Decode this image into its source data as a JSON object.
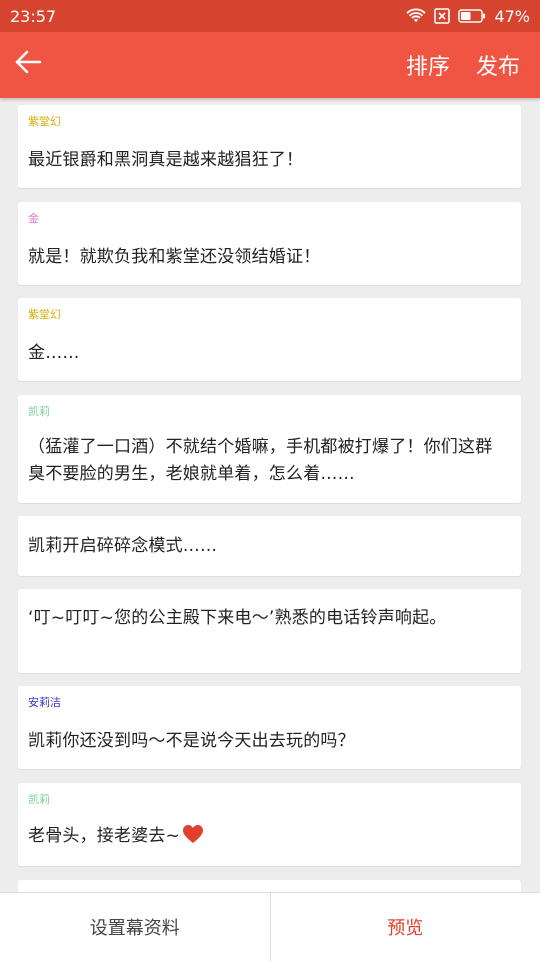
{
  "status_bar": {
    "time": "23:57",
    "battery": "47%",
    "icons": [
      "wifi-icon",
      "sim-off-icon",
      "battery-icon"
    ]
  },
  "header": {
    "back_icon": "arrow-left-icon",
    "sort_label": "排序",
    "publish_label": "发布",
    "background": "#f05442"
  },
  "messages": [
    {
      "speaker": "紫堂幻",
      "speaker_color": "#d9b000",
      "text": "最近银爵和黑洞真是越来越猖狂了！"
    },
    {
      "speaker": "金",
      "speaker_color": "#e27ad4",
      "text": "就是！就欺负我和紫堂还没领结婚证！"
    },
    {
      "speaker": "紫堂幻",
      "speaker_color": "#d9b000",
      "text": "金……"
    },
    {
      "speaker": "凯莉",
      "speaker_color": "#7fd39a",
      "text": "（猛灌了一口酒）不就结个婚嘛，手机都被打爆了！你们这群臭不要脸的男生，老娘就单着，怎么着……"
    },
    {
      "speaker": "",
      "speaker_color": "",
      "text": "凯莉开启碎碎念模式……"
    },
    {
      "speaker": "",
      "speaker_color": "",
      "text": "‘叮~叮叮~您的公主殿下来电～’熟悉的电话铃声响起。"
    },
    {
      "speaker": "安莉洁",
      "speaker_color": "#3a35c9",
      "text": "凯莉你还没到吗～不是说今天出去玩的吗？"
    },
    {
      "speaker": "凯莉",
      "speaker_color": "#7fd39a",
      "text": "老骨头，接老婆去~",
      "emoji": "heart-icon"
    }
  ],
  "footer": {
    "settings_label": "设置幕资料",
    "preview_label": "预览",
    "preview_color": "#e0402d"
  }
}
